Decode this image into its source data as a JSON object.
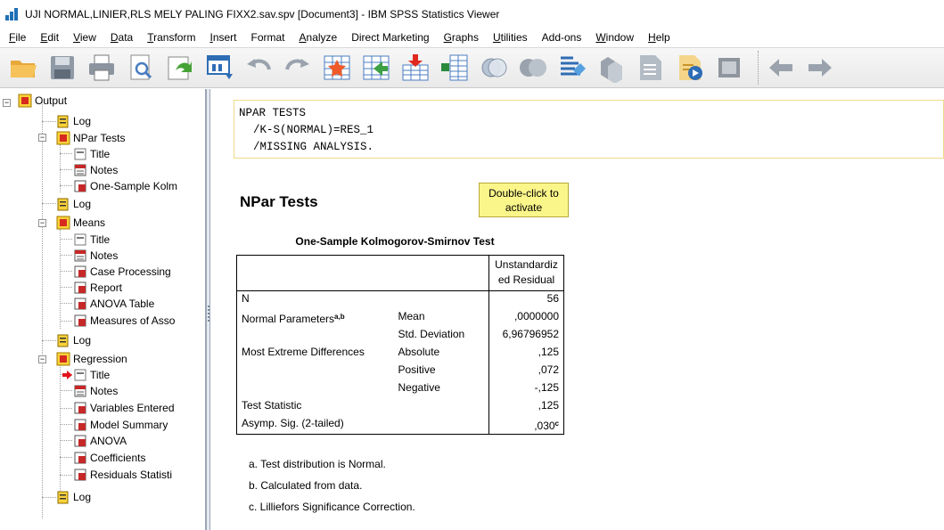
{
  "window": {
    "title": "UJI NORMAL,LINIER,RLS MELY PALING FIXX2.sav.spv [Document3] - IBM SPSS Statistics Viewer"
  },
  "menu": [
    {
      "label": "File",
      "ul": "F",
      "rest": "ile"
    },
    {
      "label": "Edit",
      "ul": "E",
      "rest": "dit"
    },
    {
      "label": "View",
      "ul": "V",
      "rest": "iew"
    },
    {
      "label": "Data",
      "ul": "D",
      "rest": "ata"
    },
    {
      "label": "Transform",
      "ul": "T",
      "rest": "ransform"
    },
    {
      "label": "Insert",
      "ul": "I",
      "rest": "nsert"
    },
    {
      "label": "Format",
      "ul": "",
      "rest": "Format"
    },
    {
      "label": "Analyze",
      "ul": "A",
      "rest": "nalyze"
    },
    {
      "label": "Direct Marketing",
      "ul": "",
      "rest": "Direct Marketing"
    },
    {
      "label": "Graphs",
      "ul": "G",
      "rest": "raphs"
    },
    {
      "label": "Utilities",
      "ul": "U",
      "rest": "tilities"
    },
    {
      "label": "Add-ons",
      "ul": "",
      "rest": "Add-ons"
    },
    {
      "label": "Window",
      "ul": "W",
      "rest": "indow"
    },
    {
      "label": "Help",
      "ul": "H",
      "rest": "elp"
    }
  ],
  "outline": {
    "root": "Output",
    "nodes": {
      "log1": "Log",
      "npar": "NPar Tests",
      "npar_title": "Title",
      "npar_notes": "Notes",
      "npar_ks": "One-Sample Kolm",
      "log2": "Log",
      "means": "Means",
      "means_title": "Title",
      "means_notes": "Notes",
      "means_case": "Case Processing",
      "means_report": "Report",
      "means_anova": "ANOVA Table",
      "means_assoc": "Measures of Asso",
      "log3": "Log",
      "regression": "Regression",
      "reg_title": "Title",
      "reg_notes": "Notes",
      "reg_vars": "Variables Entered",
      "reg_model": "Model Summary",
      "reg_anova": "ANOVA",
      "reg_coef": "Coefficients",
      "reg_resid": "Residuals Statisti",
      "log4": "Log"
    }
  },
  "syntax": {
    "line1": "NPAR TESTS",
    "line2": "/K-S(NORMAL)=RES_1",
    "line3": "/MISSING ANALYSIS."
  },
  "heading": "NPar Tests",
  "activate_note": {
    "line1": "Double-click to",
    "line2": "activate"
  },
  "table": {
    "title": "One-Sample Kolmogorov-Smirnov Test",
    "col_header_line1": "Unstandardiz",
    "col_header_line2": "ed Residual",
    "rows": [
      {
        "label": "N",
        "sub": "",
        "value": "56"
      },
      {
        "label": "Normal Parameters",
        "sup": "a,b",
        "sub": "Mean",
        "value": ",0000000"
      },
      {
        "label": "",
        "sub": "Std. Deviation",
        "value": "6,96796952"
      },
      {
        "label": "Most Extreme Differences",
        "sub": "Absolute",
        "value": ",125"
      },
      {
        "label": "",
        "sub": "Positive",
        "value": ",072"
      },
      {
        "label": "",
        "sub": "Negative",
        "value": "-,125"
      },
      {
        "label": "Test Statistic",
        "sub": "",
        "value": ",125"
      },
      {
        "label": "Asymp. Sig. (2-tailed)",
        "sub": "",
        "value": ",030",
        "sup": "c"
      }
    ]
  },
  "footnotes": {
    "a": "a. Test distribution is Normal.",
    "b": "b. Calculated from data.",
    "c": "c. Lilliefors Significance Correction."
  },
  "colors": {
    "selection_arrow": "#e3141b",
    "note_bg": "#fbf68a",
    "syntax_border": "#f2d98a"
  }
}
